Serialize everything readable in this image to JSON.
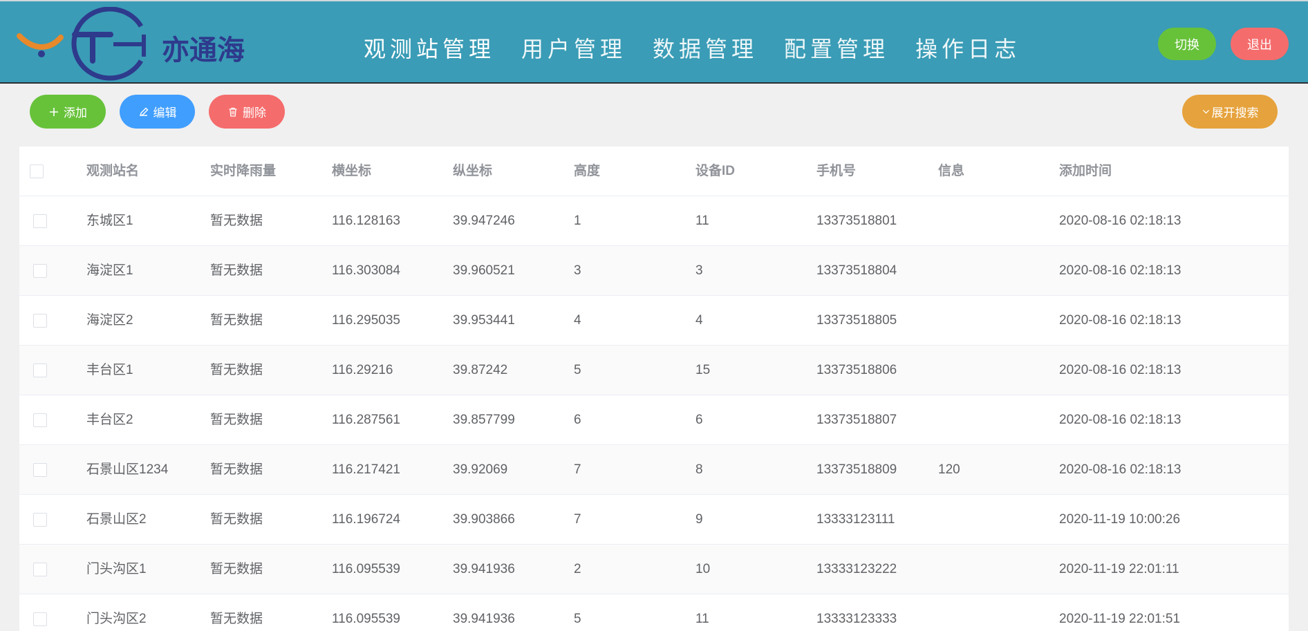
{
  "header": {
    "logo_text": "亦通海",
    "nav": [
      {
        "label": "观测站管理"
      },
      {
        "label": "用户管理"
      },
      {
        "label": "数据管理"
      },
      {
        "label": "配置管理"
      },
      {
        "label": "操作日志"
      }
    ],
    "switch_label": "切换",
    "logout_label": "退出"
  },
  "toolbar": {
    "add_label": "添加",
    "edit_label": "编辑",
    "delete_label": "删除",
    "expand_search_label": "展开搜索"
  },
  "colors": {
    "header_bg": "#3a9cb6",
    "green": "#67c23a",
    "blue": "#409eff",
    "red": "#f56c6c",
    "orange": "#e6a23c"
  },
  "table": {
    "columns": [
      "观测站名",
      "实时降雨量",
      "横坐标",
      "纵坐标",
      "高度",
      "设备ID",
      "手机号",
      "信息",
      "添加时间"
    ],
    "rows": [
      [
        "东城区1",
        "暂无数据",
        "116.128163",
        "39.947246",
        "1",
        "11",
        "13373518801",
        "",
        "2020-08-16 02:18:13"
      ],
      [
        "海淀区1",
        "暂无数据",
        "116.303084",
        "39.960521",
        "3",
        "3",
        "13373518804",
        "",
        "2020-08-16 02:18:13"
      ],
      [
        "海淀区2",
        "暂无数据",
        "116.295035",
        "39.953441",
        "4",
        "4",
        "13373518805",
        "",
        "2020-08-16 02:18:13"
      ],
      [
        "丰台区1",
        "暂无数据",
        "116.29216",
        "39.87242",
        "5",
        "15",
        "13373518806",
        "",
        "2020-08-16 02:18:13"
      ],
      [
        "丰台区2",
        "暂无数据",
        "116.287561",
        "39.857799",
        "6",
        "6",
        "13373518807",
        "",
        "2020-08-16 02:18:13"
      ],
      [
        "石景山区1234",
        "暂无数据",
        "116.217421",
        "39.92069",
        "7",
        "8",
        "13373518809",
        "120",
        "2020-08-16 02:18:13"
      ],
      [
        "石景山区2",
        "暂无数据",
        "116.196724",
        "39.903866",
        "7",
        "9",
        "13333123111",
        "",
        "2020-11-19 10:00:26"
      ],
      [
        "门头沟区1",
        "暂无数据",
        "116.095539",
        "39.941936",
        "2",
        "10",
        "13333123222",
        "",
        "2020-11-19 22:01:11"
      ],
      [
        "门头沟区2",
        "暂无数据",
        "116.095539",
        "39.941936",
        "5",
        "11",
        "13333123333",
        "",
        "2020-11-19 22:01:51"
      ]
    ]
  },
  "icons": {
    "add": "plus-icon",
    "edit": "pencil-icon",
    "delete": "trash-icon",
    "search": "chevron-down-icon"
  }
}
